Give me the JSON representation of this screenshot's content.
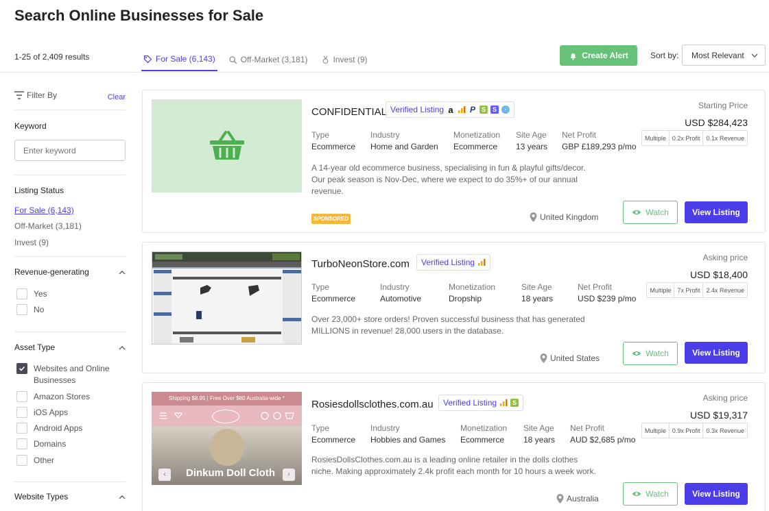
{
  "page": {
    "title": "Search Online Businesses for Sale",
    "results_count": "1-25 of 2,409 results"
  },
  "tabs": [
    {
      "label": "For Sale (6,143)",
      "icon": "tag-icon",
      "active": true
    },
    {
      "label": "Off-Market (3,181)",
      "icon": "search-icon",
      "active": false
    },
    {
      "label": "Invest (9)",
      "icon": "medal-icon",
      "active": false
    }
  ],
  "toolbar": {
    "create_alert_label": "Create Alert",
    "sort_label": "Sort by:",
    "sort_value": "Most Relevant"
  },
  "sidebar": {
    "filter_by": "Filter By",
    "clear": "Clear",
    "keyword": {
      "heading": "Keyword",
      "placeholder": "Enter keyword"
    },
    "listing_status": {
      "heading": "Listing Status",
      "items": [
        "For Sale (6,143)",
        "Off-Market (3,181)",
        "Invest (9)"
      ]
    },
    "revenue_generating": {
      "heading": "Revenue-generating",
      "options": [
        "Yes",
        "No"
      ]
    },
    "asset_type": {
      "heading": "Asset Type",
      "options": [
        "Websites and Online Businesses",
        "Amazon Stores",
        "iOS Apps",
        "Android Apps",
        "Domains",
        "Other"
      ]
    },
    "website_types": {
      "heading": "Website Types"
    }
  },
  "listings": [
    {
      "title": "CONFIDENTIAL",
      "verified": "Verified Listing",
      "type_label": "Type",
      "type": "Ecommerce",
      "industry_label": "Industry",
      "industry": "Home and Garden",
      "monetization_label": "Monetization",
      "monetization": "Ecommerce",
      "site_age_label": "Site Age",
      "site_age": "13 years",
      "net_profit_label": "Net Profit",
      "net_profit": "GBP £189,293 p/mo",
      "description": "A 14-year old ecommerce business, specialising in fun & playful gifts/decor. Our peak season is Nov-Dec, where we expect to do 35%+ of our annual revenue.",
      "price_label": "Starting Price",
      "price": "USD $284,423",
      "multiple": "Multiple",
      "profit_mult": "0.2x Profit",
      "revenue_mult": "0.1x Revenue",
      "location": "United Kingdom",
      "sponsored": "SPONSORED",
      "watch": "Watch",
      "view": "View Listing"
    },
    {
      "title": "TurboNeonStore.com",
      "verified": "Verified Listing",
      "type_label": "Type",
      "type": "Ecommerce",
      "industry_label": "Industry",
      "industry": "Automotive",
      "monetization_label": "Monetization",
      "monetization": "Dropship",
      "site_age_label": "Site Age",
      "site_age": "18 years",
      "net_profit_label": "Net Profit",
      "net_profit": "USD $239 p/mo",
      "description": "Over 23,000+ store orders! Proven successful business that has generated MILLIONS in revenue! 28,000 users in the database.",
      "price_label": "Asking price",
      "price": "USD $18,400",
      "multiple": "Multiple",
      "profit_mult": "7x Profit",
      "revenue_mult": "2.4x Revenue",
      "location": "United States",
      "watch": "Watch",
      "view": "View Listing"
    },
    {
      "title": "Rosiesdollsclothes.com.au",
      "verified": "Verified Listing",
      "type_label": "Type",
      "type": "Ecommerce",
      "industry_label": "Industry",
      "industry": "Hobbies and Games",
      "monetization_label": "Monetization",
      "monetization": "Ecommerce",
      "site_age_label": "Site Age",
      "site_age": "18 years",
      "net_profit_label": "Net Profit",
      "net_profit": "AUD $2,685 p/mo",
      "description": "RosiesDollsClothes.com.au is a leading online retailer in the dolls clothes niche. Making approximately 2.4k profit each month for 10 hours a week work.",
      "price_label": "Asking price",
      "price": "USD $19,317",
      "multiple": "Multiple",
      "profit_mult": "0.9x Profit",
      "revenue_mult": "0.3x Revenue",
      "location": "Australia",
      "watch": "Watch",
      "view": "View Listing",
      "thumb_banner": "Shipping $8.95 | Free Over $80 Australia-wide *",
      "thumb_caption": "Dinkum Doll Cloth"
    }
  ],
  "colors": {
    "accent": "#4b3de8",
    "green": "#66c279",
    "sponsored": "#f5b63c"
  }
}
